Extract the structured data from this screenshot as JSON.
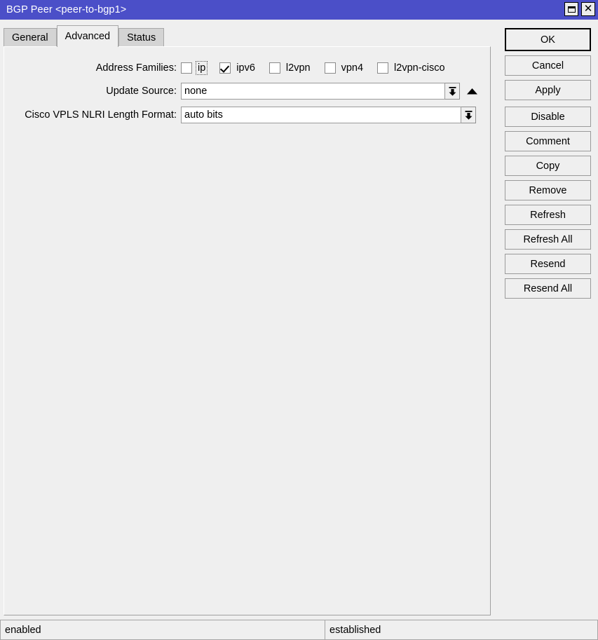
{
  "window": {
    "title": "BGP Peer <peer-to-bgp1>",
    "maximize_icon": "maximize-icon",
    "close_icon": "close-icon",
    "close_glyph": "✕"
  },
  "tabs": [
    {
      "label": "General",
      "selected": false
    },
    {
      "label": "Advanced",
      "selected": true
    },
    {
      "label": "Status",
      "selected": false
    }
  ],
  "form": {
    "address_families": {
      "label": "Address Families:",
      "options": [
        {
          "label": "ip",
          "checked": false,
          "focused": true
        },
        {
          "label": "ipv6",
          "checked": true,
          "focused": false
        },
        {
          "label": "l2vpn",
          "checked": false,
          "focused": false
        },
        {
          "label": "vpn4",
          "checked": false,
          "focused": false
        },
        {
          "label": "l2vpn-cisco",
          "checked": false,
          "focused": false
        }
      ]
    },
    "update_source": {
      "label": "Update Source:",
      "value": "none",
      "dropdown_icon": "dropdown-arrow-icon",
      "collapse_icon": "up-arrow-icon"
    },
    "nlri_length_format": {
      "label": "Cisco VPLS NLRI Length Format:",
      "value": "auto bits",
      "dropdown_icon": "dropdown-arrow-icon"
    }
  },
  "buttons": [
    {
      "label": "OK",
      "default": true,
      "gap_above": false
    },
    {
      "label": "Cancel",
      "default": false,
      "gap_above": false
    },
    {
      "label": "Apply",
      "default": false,
      "gap_above": false
    },
    {
      "label": "Disable",
      "default": false,
      "gap_above": true
    },
    {
      "label": "Comment",
      "default": false,
      "gap_above": false
    },
    {
      "label": "Copy",
      "default": false,
      "gap_above": false
    },
    {
      "label": "Remove",
      "default": false,
      "gap_above": false
    },
    {
      "label": "Refresh",
      "default": false,
      "gap_above": false
    },
    {
      "label": "Refresh All",
      "default": false,
      "gap_above": false
    },
    {
      "label": "Resend",
      "default": false,
      "gap_above": false
    },
    {
      "label": "Resend All",
      "default": false,
      "gap_above": false
    }
  ],
  "statusbar": {
    "left": "enabled",
    "right": "established"
  },
  "colors": {
    "titlebar": "#4b4fc8",
    "titlebar_text": "#ffffff",
    "window_background": "#efefef",
    "tab_inactive": "#d4d4d4",
    "field_background": "#ffffff",
    "border": "#9a9a9a"
  }
}
